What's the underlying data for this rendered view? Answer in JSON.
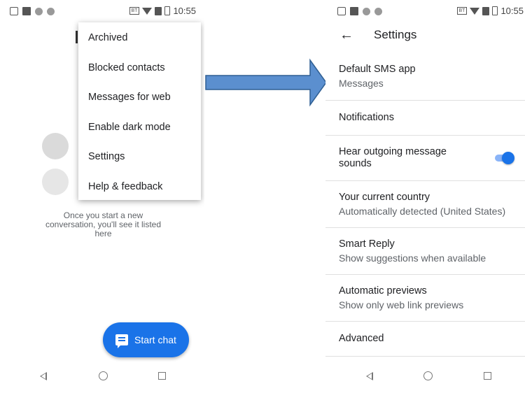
{
  "status_bar": {
    "time": "10:55",
    "bt": "BT"
  },
  "left_screen": {
    "overflow_menu": {
      "items": [
        {
          "label": "Archived"
        },
        {
          "label": "Blocked contacts"
        },
        {
          "label": "Messages for web"
        },
        {
          "label": "Enable dark mode"
        },
        {
          "label": "Settings"
        },
        {
          "label": "Help & feedback"
        }
      ]
    },
    "empty_state_text": "Once you start a new conversation, you'll see it listed here",
    "fab": {
      "label": "Start chat",
      "icon": "chat-bubble-icon",
      "color": "#1a73e8"
    }
  },
  "right_screen": {
    "header": {
      "back_icon": "back-arrow-icon",
      "title": "Settings"
    },
    "settings": [
      {
        "title": "Default SMS app",
        "subtitle": "Messages"
      },
      {
        "title": "Notifications",
        "subtitle": ""
      },
      {
        "title": "Hear outgoing message sounds",
        "subtitle": "",
        "toggle": true
      },
      {
        "title": "Your current country",
        "subtitle": "Automatically detected (United States)"
      },
      {
        "title": "Smart Reply",
        "subtitle": "Show suggestions when available"
      },
      {
        "title": "Automatic previews",
        "subtitle": "Show only web link previews"
      },
      {
        "title": "Advanced",
        "subtitle": ""
      }
    ]
  },
  "colors": {
    "accent": "#1a73e8",
    "arrow_fill": "#5b8fcf",
    "arrow_stroke": "#2f5f93"
  }
}
